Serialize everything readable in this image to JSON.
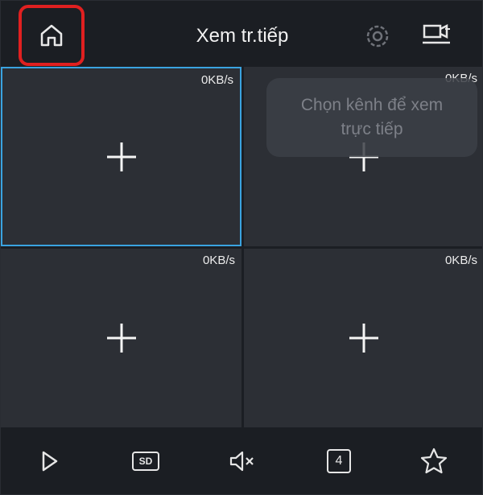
{
  "header": {
    "title": "Xem tr.tiếp",
    "icons": {
      "home": "home-icon",
      "settings": "gear-icon",
      "device": "device-switch-icon"
    },
    "highlight_color": "#e02020"
  },
  "grid": {
    "selected_border_color": "#3aa3e0",
    "cells": [
      {
        "rate": "0KB/s",
        "selected": true
      },
      {
        "rate": "0KB/s",
        "selected": false
      },
      {
        "rate": "0KB/s",
        "selected": false
      },
      {
        "rate": "0KB/s",
        "selected": false
      }
    ]
  },
  "tooltip": {
    "line1": "Chọn kênh để xem",
    "line2": "trực tiếp"
  },
  "toolbar": {
    "sd_label": "SD",
    "layout_count": "4",
    "icons": [
      "play-icon",
      "sd-quality-icon",
      "mute-icon",
      "layout-icon",
      "favorite-star-icon"
    ]
  }
}
